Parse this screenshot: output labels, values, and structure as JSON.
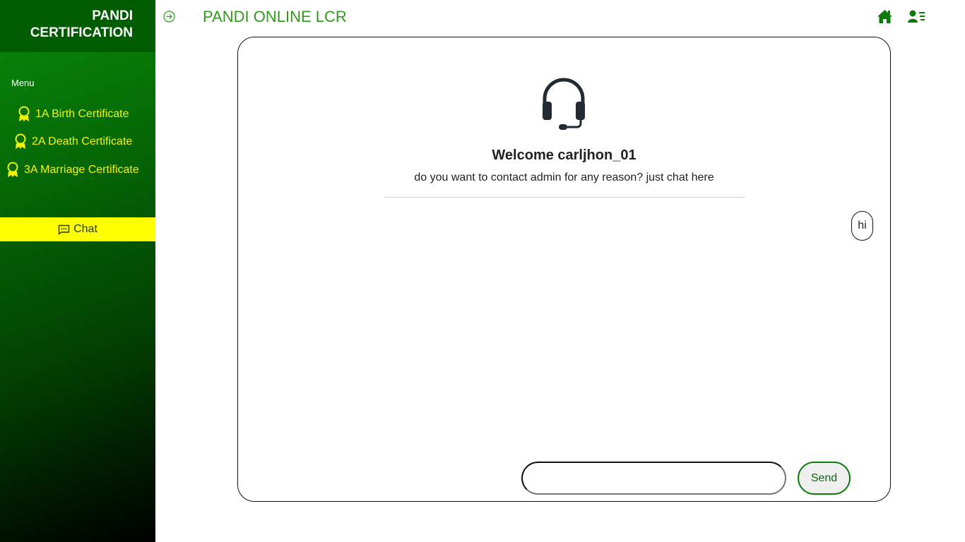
{
  "sidebar": {
    "brand_line1": "PANDI",
    "brand_line2": "CERTIFICATION",
    "menu_label": "Menu",
    "items": [
      {
        "label": "1A Birth Certificate",
        "icon": "award-icon"
      },
      {
        "label": "2A Death Certificate",
        "icon": "award-icon"
      },
      {
        "label": "3A Marriage Certificate",
        "icon": "award-icon"
      }
    ],
    "chat": {
      "label": "Chat",
      "icon": "chat-dots-icon",
      "active": true
    }
  },
  "header": {
    "title": "PANDI ONLINE LCR",
    "toggle_icon": "arrow-right-circle-icon",
    "home_icon": "home-icon",
    "profile_icon": "person-lines-icon"
  },
  "chat_panel": {
    "icon": "headset-icon",
    "welcome": "Welcome carljhon_01",
    "subtitle": "do you want to contact admin for any reason? just chat here",
    "messages": [
      {
        "text": "hi",
        "side": "right"
      }
    ],
    "input": {
      "value": "",
      "placeholder": ""
    },
    "send_label": "Send"
  },
  "colors": {
    "sidebar_top": "#0a8a0a",
    "sidebar_bottom": "#000000",
    "brand_bg": "#005c00",
    "nav_text": "#f4f400",
    "chat_active_bg": "#ffff00",
    "title": "#2f9a1b",
    "icon_green": "#0b7a0b"
  }
}
